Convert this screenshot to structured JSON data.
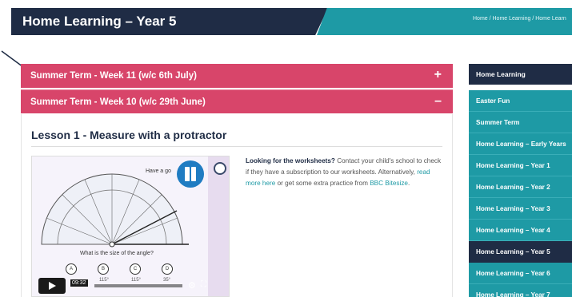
{
  "header": {
    "title": "Home Learning – Year 5",
    "breadcrumb": "Home / Home Learning / Home Learn"
  },
  "accordion": [
    {
      "label": "Summer Term - Week 11 (w/c 6th July)",
      "toggle": "+"
    },
    {
      "label": "Summer Term - Week 10 (w/c 29th June)",
      "toggle": "–"
    }
  ],
  "lesson": {
    "title": "Lesson 1 - Measure with a protractor",
    "video": {
      "have_go": "Have a go",
      "question": "What is the size of the angle?",
      "options": [
        "A",
        "B",
        "C",
        "D"
      ],
      "option_values": [
        "",
        "115°",
        "115°",
        "35°"
      ],
      "time": "09:32"
    },
    "info": {
      "bold": "Looking for the worksheets?",
      "text1": " Contact your child's school to check if they have a subscription to our worksheets. Alternatively, ",
      "link1": "read more here",
      "text2": " or get some extra practice from ",
      "link2": "BBC Bitesize",
      "text3": "."
    }
  },
  "sidebar": {
    "heading": "Home Learning",
    "items": [
      {
        "label": "Easter Fun"
      },
      {
        "label": "Summer Term"
      },
      {
        "label": "Home Learning – Early Years"
      },
      {
        "label": "Home Learning – Year 1"
      },
      {
        "label": "Home Learning – Year 2"
      },
      {
        "label": "Home Learning – Year 3"
      },
      {
        "label": "Home Learning – Year 4"
      },
      {
        "label": "Home Learning – Year 5",
        "active": true
      },
      {
        "label": "Home Learning – Year 6"
      },
      {
        "label": "Home Learning – Year 7"
      }
    ]
  },
  "colors": {
    "navy": "#1f2c45",
    "teal": "#1e9aa5",
    "accordion_pink": "#d8456a",
    "play_blue": "#1f7cc2"
  }
}
